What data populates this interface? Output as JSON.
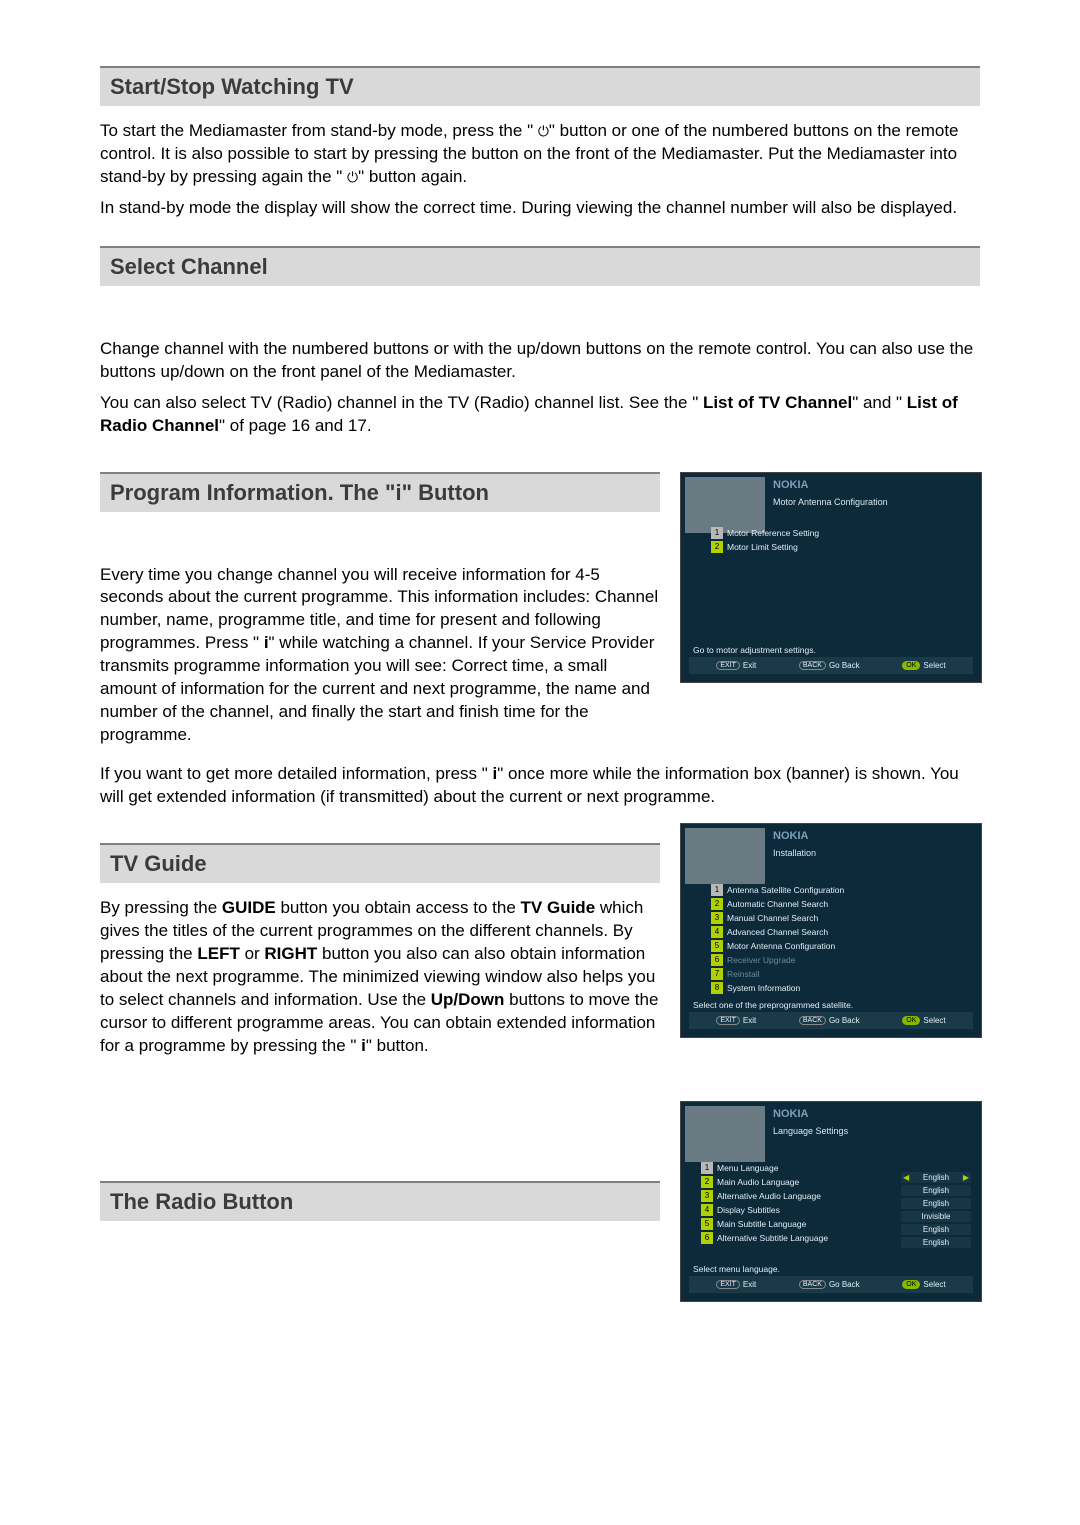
{
  "sections": {
    "start": {
      "heading": "Start/Stop Watching TV",
      "p1a": "To start the Mediamaster from stand-by mode, press the \" ",
      "p1b": "\" button or one of the numbered buttons on the remote control. It is also possible to start by pressing the button on the front of the Mediamaster. Put the Mediamaster into stand-by by pressing again the \" ",
      "p1c": "\" button again.",
      "p2": "In stand-by mode the display will show the correct time. During viewing the channel number will also be displayed."
    },
    "select": {
      "heading": "Select Channel",
      "p1": "Change channel with the numbered buttons or with the up/down buttons on the remote control. You can also use the buttons up/down on the front panel of the Mediamaster.",
      "p2a": "You can also select TV (Radio) channel in the TV (Radio) channel list. See the \" ",
      "p2b_bold": "List of TV Channel",
      "p2c": "\" and \" ",
      "p2d_bold": "List of Radio Channel",
      "p2e": "\" of page 16 and 17."
    },
    "program": {
      "heading": "Program Information. The \"i\" Button",
      "p1a": "Every time you change channel you will receive information for 4-5 seconds about the current programme. This information includes: Channel number, name, programme title, and time for present and following programmes.   Press \" ",
      "p1b": "\" while watching a channel. If your Service Provider transmits programme information you will see: Correct time, a small amount of information for the current and next programme, the name and number of the channel, and finally the start and finish time for the programme.",
      "p2a": "If you want to get more detailed information, press \" ",
      "p2b": "\" once more while the information box (banner) is shown. You will get extended information (if transmitted) about the current or next programme."
    },
    "guide": {
      "heading": "TV Guide",
      "p1a": "By pressing the ",
      "p1b_bold": "GUIDE",
      "p1c": " button you obtain access to the ",
      "p1d_bold": "TV Guide",
      "p1e": " which gives the titles of the current programmes on the different channels. By pressing the ",
      "p1f_bold": "LEFT",
      "p1g": " or ",
      "p1h_bold": "RIGHT",
      "p1i": " button you also can also obtain information about the next programme. The minimized viewing window also helps you to select channels and information. Use the ",
      "p1j_bold": "Up/Down",
      "p1k": " buttons to move the cursor to different programme areas. You can obtain extended information for a programme by pressing the \" ",
      "p1l": "\" button."
    },
    "radio": {
      "heading": "The Radio Button"
    }
  },
  "shots": {
    "brand": "NOKIA",
    "exit": "Exit",
    "goback": "Go Back",
    "select": "Select",
    "exit_btn": "EXIT",
    "back_btn": "BACK",
    "ok_btn": "OK",
    "motor": {
      "title": "Motor Antenna Configuration",
      "items": [
        "Motor Reference Setting",
        "Motor Limit Setting"
      ],
      "hint": "Go to motor adjustment settings."
    },
    "install": {
      "title": "Installation",
      "items": [
        "Antenna Satellite Configuration",
        "Automatic Channel Search",
        "Manual Channel Search",
        "Advanced Channel Search",
        "Motor Antenna Configuration",
        "Receiver Upgrade",
        "Reinstall",
        "System Information"
      ],
      "hint": "Select one of the preprogrammed satellite."
    },
    "lang": {
      "title": "Language Settings",
      "items": [
        "Menu Language",
        "Main Audio Language",
        "Alternative Audio Language",
        "Display Subtitles",
        "Main Subtitle Language",
        "Alternative Subtitle Language"
      ],
      "values": [
        "English",
        "English",
        "English",
        "Invisible",
        "English",
        "English"
      ],
      "hint": "Select menu language."
    }
  }
}
